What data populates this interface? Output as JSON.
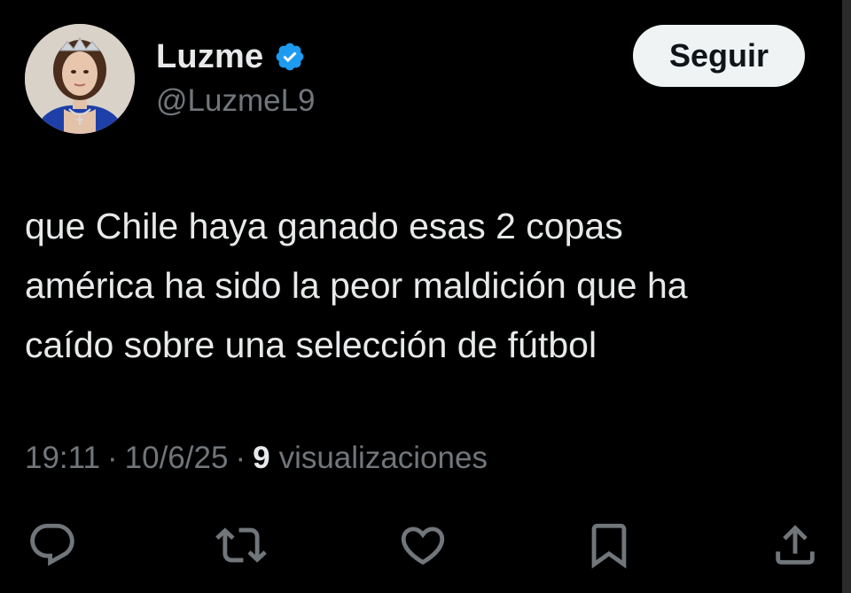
{
  "user": {
    "display_name": "Luzme",
    "handle": "@LuzmeL9",
    "verified": true,
    "verified_color": "#1d9bf0"
  },
  "follow_button": {
    "label": "Seguir"
  },
  "tweet": {
    "lines": [
      "que Chile haya ganado esas 2 copas",
      "américa ha sido la peor maldición que ha",
      "caído sobre una selección de fútbol"
    ]
  },
  "meta": {
    "time": "19:11",
    "separator": "·",
    "date": "10/6/25",
    "views_count": "9",
    "views_label": "visualizaciones"
  },
  "actions": [
    {
      "name": "reply",
      "icon": "reply-icon"
    },
    {
      "name": "retweet",
      "icon": "retweet-icon"
    },
    {
      "name": "like",
      "icon": "heart-icon"
    },
    {
      "name": "bookmark",
      "icon": "bookmark-icon"
    },
    {
      "name": "share",
      "icon": "share-icon"
    }
  ],
  "colors": {
    "background": "#000000",
    "text_primary": "#e7e9ea",
    "text_secondary": "#71767b",
    "button_bg": "#eff3f4"
  }
}
